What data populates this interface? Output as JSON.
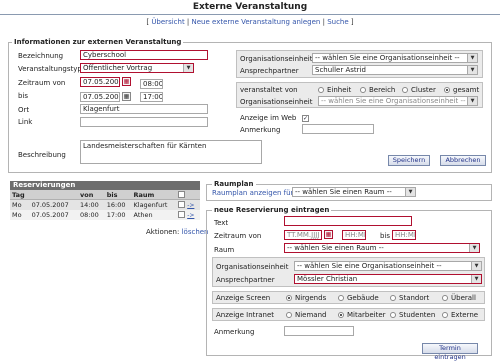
{
  "page": {
    "title": "Externe Veranstaltung"
  },
  "nav": {
    "bracket_open": "[",
    "sep": "|",
    "bracket_close": "]",
    "items": [
      "Übersicht",
      "Neue externe Veranstaltung anlegen",
      "Suche"
    ]
  },
  "info": {
    "legend": "Informationen zur externen Veranstaltung",
    "bezeichnung_label": "Bezeichnung",
    "bezeichnung_value": "Cyberschool",
    "typ_label": "Veranstaltungstyp",
    "typ_value": "Öffentlicher Vortrag",
    "von_label": "Zeitraum von",
    "von_date": "07.05.2007",
    "von_time": "08:00",
    "bis_label": "bis",
    "bis_date": "07.05.2007",
    "bis_time": "17:00",
    "ort_label": "Ort",
    "ort_value": "Klagenfurt",
    "link_label": "Link",
    "link_value": "",
    "beschreibung_label": "Beschreibung",
    "beschreibung_value": "Landesmeisterschaften für Kärnten",
    "org_label": "Organisationseinheit",
    "org_value": "-- wählen Sie eine Organisationseinheit --",
    "ansprech_label": "Ansprechpartner",
    "ansprech_value": "Schuller Astrid",
    "veranstaltet_label": "veranstaltet von",
    "veranstaltet_options": [
      "Einheit",
      "Bereich",
      "Cluster",
      "gesamt"
    ],
    "veranstaltet_selected": "gesamt",
    "org2_label": "Organisationseinheit",
    "org2_value": "-- wählen Sie eine Organisationseinheit --",
    "web_label": "Anzeige im Web",
    "web_check": "✓",
    "anmerkung_label": "Anmerkung",
    "anmerkung_value": "",
    "save_label": "Speichern",
    "cancel_label": "Abbrechen"
  },
  "reservations": {
    "header": "Reservierungen",
    "columns": [
      "Tag",
      "von",
      "bis",
      "Raum"
    ],
    "rows": [
      {
        "tag": "Mo",
        "date": "07.05.2007",
        "von": "14:00",
        "bis": "16:00",
        "raum": "Klagenfurt",
        "arrow": "->"
      },
      {
        "tag": "Mo",
        "date": "07.05.2007",
        "von": "08:00",
        "bis": "17:00",
        "raum": "Athen",
        "arrow": "->"
      }
    ],
    "actions_label": "Aktionen:",
    "actions_delete": "löschen"
  },
  "raumplan": {
    "legend": "Raumplan",
    "show_label": "Raumplan anzeigen für",
    "room_value": "-- wählen Sie einen Raum --"
  },
  "newres": {
    "legend": "neue Reservierung eintragen",
    "text_label": "Text",
    "text_value": "",
    "zeitraum_label": "Zeitraum von",
    "date_placeholder": "TT.MM.JJJJ",
    "time_placeholder": "HH:MM",
    "bis_label": "bis",
    "bis_placeholder": "HH:MM",
    "raum_label": "Raum",
    "raum_value": "-- wählen Sie einen Raum --",
    "org_label": "Organisationseinheit",
    "org_value": "-- wählen Sie eine Organisationseinheit --",
    "ansprech_label": "Ansprechpartner",
    "ansprech_value": "Mössler Christian",
    "screen_label": "Anzeige Screen",
    "screen_options": [
      "Nirgends",
      "Gebäude",
      "Standort",
      "Überall"
    ],
    "screen_selected": "Nirgends",
    "intranet_label": "Anzeige Intranet",
    "intranet_options": [
      "Niemand",
      "Mitarbeiter",
      "Studenten",
      "Externe"
    ],
    "intranet_selected": "Mitarbeiter",
    "anmerkung_label": "Anmerkung",
    "anmerkung_value": "",
    "submit_label": "Termin eintragen"
  },
  "colors": {
    "accent_red": "#b01030",
    "link_blue": "#3355aa",
    "border_grey": "#b4b4b4"
  }
}
